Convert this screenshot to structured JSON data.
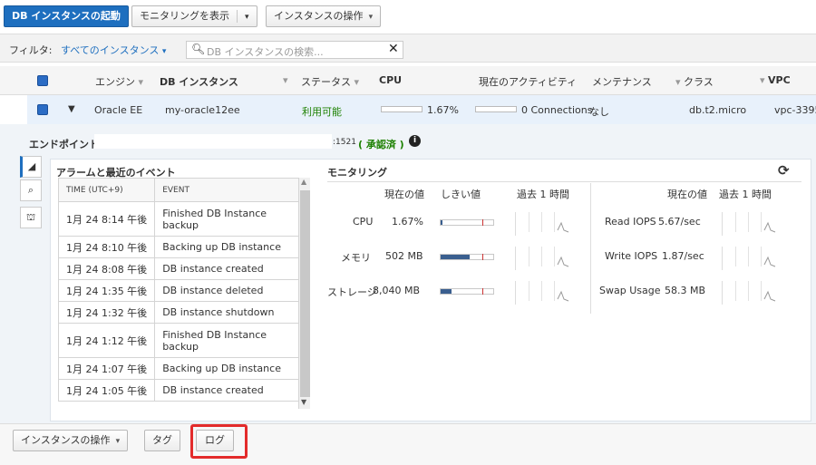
{
  "toolbar": {
    "launch_label": "DB インスタンスの起動",
    "monitoring_label": "モニタリングを表示",
    "actions_label": "インスタンスの操作"
  },
  "filter": {
    "label": "フィルタ:",
    "value": "すべてのインスタンス",
    "search_placeholder": "DB インスタンスの検索..."
  },
  "columns": [
    "エンジン",
    "DB インスタンス",
    "ステータス",
    "CPU",
    "現在のアクティビティ",
    "メンテナンス",
    "クラス",
    "VPC"
  ],
  "row": {
    "engine": "Oracle EE",
    "instance": "my-oracle12ee",
    "status": "利用可能",
    "cpu": "1.67%",
    "activity": "0 Connections",
    "maintenance": "なし",
    "class": "db.t2.micro",
    "vpc": "vpc-3395"
  },
  "colors": {
    "accent": "#1e6fbf",
    "status_ok": "#1d8102",
    "highlight": "#e32b2b"
  },
  "endpoint": {
    "label": "エンドポイント:",
    "port": ":1521",
    "auth": "( 承認済 )"
  },
  "events": {
    "title": "アラームと最近のイベント",
    "col_time": "TIME (UTC+9)",
    "col_event": "EVENT",
    "rows": [
      {
        "time": "1月 24 8:14 午後",
        "event": "Finished DB Instance backup"
      },
      {
        "time": "1月 24 8:10 午後",
        "event": "Backing up DB instance"
      },
      {
        "time": "1月 24 8:08 午後",
        "event": "DB instance created"
      },
      {
        "time": "1月 24 1:35 午後",
        "event": "DB instance deleted"
      },
      {
        "time": "1月 24 1:32 午後",
        "event": "DB instance shutdown"
      },
      {
        "time": "1月 24 1:12 午後",
        "event": "Finished DB Instance backup"
      },
      {
        "time": "1月 24 1:07 午後",
        "event": "Backing up DB instance"
      },
      {
        "time": "1月 24 1:05 午後",
        "event": "DB instance created"
      }
    ]
  },
  "monitoring": {
    "title": "モニタリング",
    "head_current": "現在の値",
    "head_threshold": "しきい値",
    "head_past": "過去 1 時間",
    "metrics_left": [
      {
        "name": "CPU",
        "value": "1.67%",
        "level": 0.02
      },
      {
        "name": "メモリ",
        "value": "502 MB",
        "level": 0.55
      },
      {
        "name": "ストレージ",
        "value": "8,040 MB",
        "level": 0.2
      }
    ],
    "metrics_right": [
      {
        "name": "Read IOPS",
        "value": "5.67/sec"
      },
      {
        "name": "Write IOPS",
        "value": "1.87/sec"
      },
      {
        "name": "Swap Usage",
        "value": "58.3 MB"
      }
    ]
  },
  "bottom": {
    "actions_label": "インスタンスの操作",
    "tags_label": "タグ",
    "logs_label": "ログ"
  }
}
